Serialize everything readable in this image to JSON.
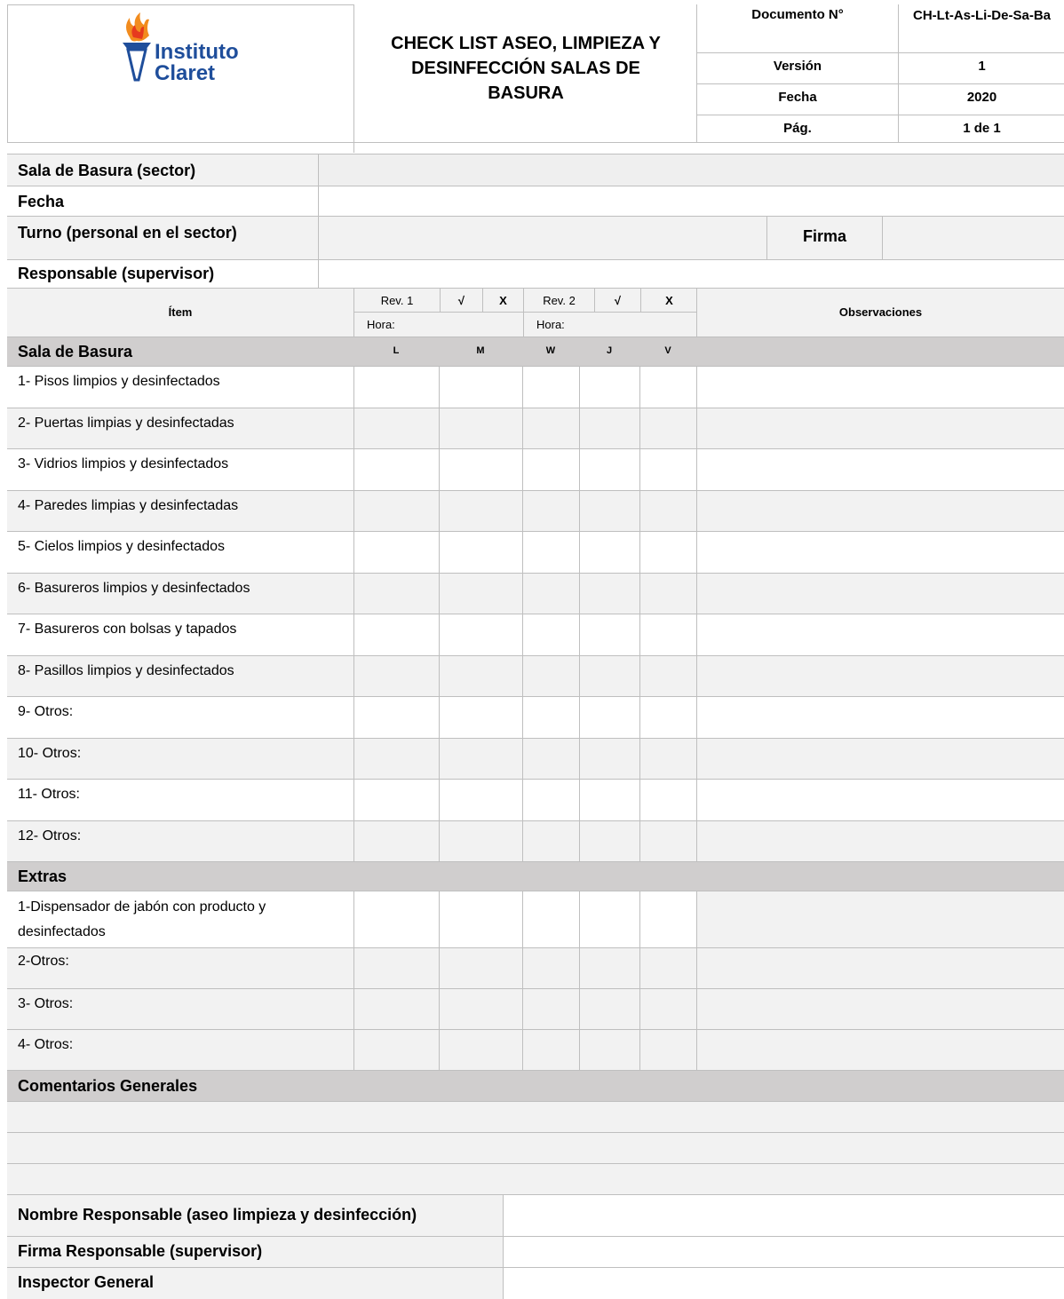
{
  "header": {
    "logo_line1": "Instituto",
    "logo_line2": "Claret",
    "title": "CHECK LIST ASEO, LIMPIEZA Y DESINFECCIÓN SALAS DE BASURA",
    "meta": [
      {
        "label": "Documento N°",
        "value": "CH-Lt-As-Li-De-Sa-Ba"
      },
      {
        "label": "Versión",
        "value": "1"
      },
      {
        "label": "Fecha",
        "value": "2020"
      },
      {
        "label": "Pág.",
        "value": "1 de 1"
      }
    ]
  },
  "info": {
    "sala_label": "Sala de Basura (sector)",
    "fecha_label": "Fecha",
    "turno_label": "Turno (personal en el sector)",
    "firma_label": "Firma",
    "responsable_label": "Responsable (supervisor)"
  },
  "table_header": {
    "item": "Ítem",
    "rev1": "Rev. 1",
    "rev2": "Rev. 2",
    "check": "√",
    "cross": "X",
    "hora": "Hora:",
    "observaciones": "Observaciones"
  },
  "section1": {
    "title": "Sala de Basura",
    "days": [
      "L",
      "M",
      "W",
      "J",
      "V"
    ],
    "items": [
      "1- Pisos limpios y desinfectados",
      "2- Puertas limpias y desinfectadas",
      "3- Vidrios limpios y desinfectados",
      "4- Paredes limpias y desinfectadas",
      "5- Cielos limpios y desinfectados",
      "6- Basureros limpios y desinfectados",
      "7- Basureros con bolsas y tapados",
      "8- Pasillos limpios y desinfectados",
      "9- Otros:",
      "10- Otros:",
      "11- Otros:",
      "12- Otros:"
    ]
  },
  "extras": {
    "title": "Extras",
    "items": [
      "1-Dispensador de jabón con producto y desinfectados",
      "2-Otros:",
      "3- Otros:",
      "4- Otros:"
    ]
  },
  "comments": {
    "title": "Comentarios Generales"
  },
  "footer": {
    "nombre_label": "Nombre Responsable (aseo limpieza y desinfección)",
    "firma_label": "Firma Responsable (supervisor)",
    "inspector_label": "Inspector General"
  },
  "colors": {
    "logo_blue": "#1f4e9b",
    "flame": "#f28c1e",
    "light_gray": "#f2f2f2",
    "section_gray": "#d0cece"
  }
}
